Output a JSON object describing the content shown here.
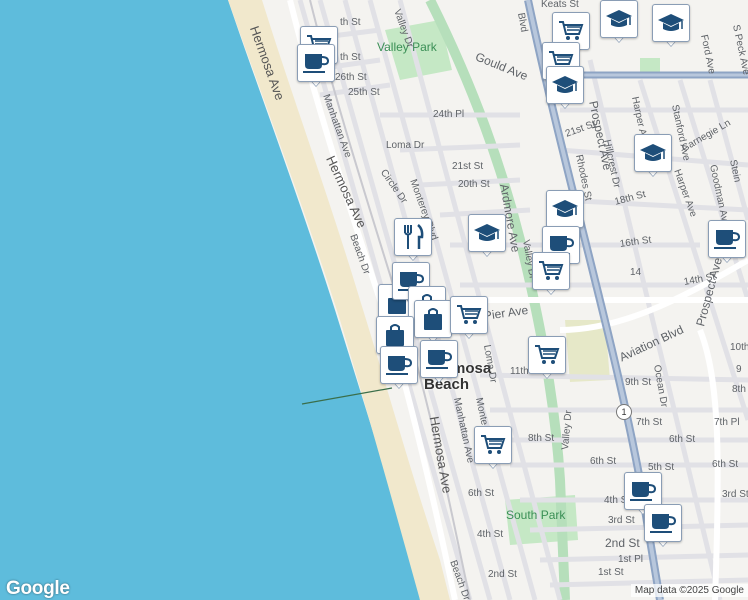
{
  "map": {
    "colors": {
      "water": "#5ebcdc",
      "sand": "#f1e8cc",
      "land": "#f4f3f0",
      "park": "#c5e8c5",
      "road": "#ffffff",
      "road_outline": "#d6d6d6",
      "major_road": "#8ea4c4",
      "rail_green": "#b6dfbb"
    },
    "city": {
      "line1": "Hermosa",
      "line2": "Beach"
    },
    "parks": {
      "valley_park": "Valley Park",
      "south_park": "South Park"
    },
    "streets": {
      "hermosa_ave_n": "Hermosa Ave",
      "th_st": "th St",
      "th_st2": "th St",
      "st_26": "26th St",
      "st_25": "25th St",
      "manhattan_ave_n": "Manhattan Ave",
      "valley_dr_n": "Valley Dr",
      "gould_ave": "Gould Ave",
      "pl_24": "24th Pl",
      "keats_st": "Keats St",
      "blvd": "Blvd",
      "prospect_ave": "Prospect Ave",
      "harper_ave_1": "Harper Ave",
      "stanford_ave": "Stanford Ave",
      "ford_ave": "Ford Ave",
      "s_peck_ave": "S Peck Ave",
      "carnegie_ln": "Carnegie Ln",
      "st_21": "21st St",
      "st_21b": "21st St",
      "hillcrest_dr": "Hillcrest Dr",
      "rhodes_st": "Rhodes St",
      "st_18": "18th St",
      "loma_dr": "Loma Dr",
      "hermosa_ave_mid": "Hermosa Ave",
      "circle_dr": "Circle Dr",
      "monterey_blvd": "Monterey Blvd",
      "st_20": "20th St",
      "ardmore_ave": "Ardmore Ave",
      "harper_ave_2": "Harper Ave",
      "goodman_av": "Goodman Av",
      "stein": "Stein",
      "beach_dr_n": "Beach Dr",
      "st_16": "16th St",
      "st_14": "14th St",
      "valley_dr_mid": "Valley Dr",
      "pier_ave": "Pier Ave",
      "aviation_blvd": "Aviation Blvd",
      "prospect_ave_s": "Prospect Ave",
      "st_10": "10th",
      "st_11": "11th St",
      "loma_dr_s": "Loma Dr",
      "ocean_dr": "Ocean Dr",
      "st_9": "9th St",
      "st_8_e": "8th",
      "manhattan_ave_s": "Manhattan Ave",
      "monte": "Monte",
      "st_8": "8th St",
      "st_7": "7th St",
      "pl_7": "7th Pl",
      "hermosa_ave_s": "Hermosa Ave",
      "valley_dr_s": "Valley Dr",
      "st_6": "6th St",
      "st_6b": "6th St",
      "st_6c": "6th St",
      "st_5": "5th St",
      "st_6w": "6th St",
      "st_4": "4th St",
      "st_4b": "4th St",
      "st_3": "3rd St",
      "st_3b": "3rd St",
      "st_2": "2nd St",
      "st_2b": "2nd St",
      "pl_1": "1st Pl",
      "st_1": "1st St",
      "beach_dr_s": "Beach Dr",
      "st_14b": "14",
      "st_9b": "9"
    },
    "highway_shield": "1",
    "markers": [
      {
        "icon": "shopping-cart-icon"
      },
      {
        "icon": "coffee-cup-icon"
      },
      {
        "icon": "shopping-cart-icon"
      },
      {
        "icon": "graduation-cap-icon"
      },
      {
        "icon": "graduation-cap-icon"
      },
      {
        "icon": "shopping-cart-icon"
      },
      {
        "icon": "graduation-cap-icon"
      },
      {
        "icon": "graduation-cap-icon"
      },
      {
        "icon": "graduation-cap-icon"
      },
      {
        "icon": "coffee-cup-icon"
      },
      {
        "icon": "restaurant-icon"
      },
      {
        "icon": "graduation-cap-icon"
      },
      {
        "icon": "coffee-cup-icon"
      },
      {
        "icon": "shopping-cart-icon"
      },
      {
        "icon": "shopping-bag-icon"
      },
      {
        "icon": "coffee-cup-icon"
      },
      {
        "icon": "shopping-bag-icon"
      },
      {
        "icon": "shopping-bag-icon"
      },
      {
        "icon": "shopping-cart-icon"
      },
      {
        "icon": "shopping-bag-icon"
      },
      {
        "icon": "coffee-cup-icon"
      },
      {
        "icon": "coffee-cup-icon"
      },
      {
        "icon": "shopping-cart-icon"
      },
      {
        "icon": "shopping-cart-icon"
      },
      {
        "icon": "coffee-cup-icon"
      },
      {
        "icon": "coffee-cup-icon"
      }
    ],
    "google_logo": "Google",
    "attribution": "Map data ©2025 Google"
  }
}
